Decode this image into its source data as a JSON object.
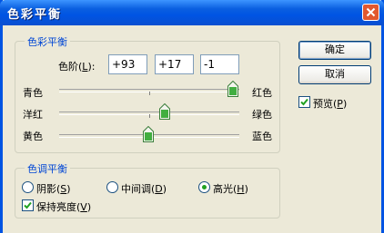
{
  "window": {
    "title": "色彩平衡"
  },
  "color_balance_group": {
    "legend": "色彩平衡",
    "levels_label": "色阶(",
    "levels_mnemonic": "L",
    "levels_label_end": "):",
    "levels": [
      "+93",
      "+17",
      "-1"
    ],
    "sliders": [
      {
        "left_label": "青色",
        "right_label": "红色",
        "value": 93
      },
      {
        "left_label": "洋红",
        "right_label": "绿色",
        "value": 17
      },
      {
        "left_label": "黄色",
        "right_label": "蓝色",
        "value": -1
      }
    ],
    "slider_range": [
      -100,
      100
    ]
  },
  "tone_balance_group": {
    "legend": "色调平衡",
    "options": [
      {
        "label": "阴影(",
        "mnemonic": "S",
        "end": ")",
        "selected": false
      },
      {
        "label": "中间调(",
        "mnemonic": "D",
        "end": ")",
        "selected": false
      },
      {
        "label": "高光(",
        "mnemonic": "H",
        "end": ")",
        "selected": true
      }
    ],
    "preserve_luminosity": {
      "label": "保持亮度(",
      "mnemonic": "V",
      "end": ")",
      "checked": true
    }
  },
  "buttons": {
    "ok": "确定",
    "cancel": "取消"
  },
  "preview": {
    "label": "预览(",
    "mnemonic": "P",
    "end": ")",
    "checked": true
  },
  "colors": {
    "titlebar": "#0054e3",
    "face": "#ece9d8",
    "legend": "#0046d5",
    "thumb": "#21a121"
  }
}
